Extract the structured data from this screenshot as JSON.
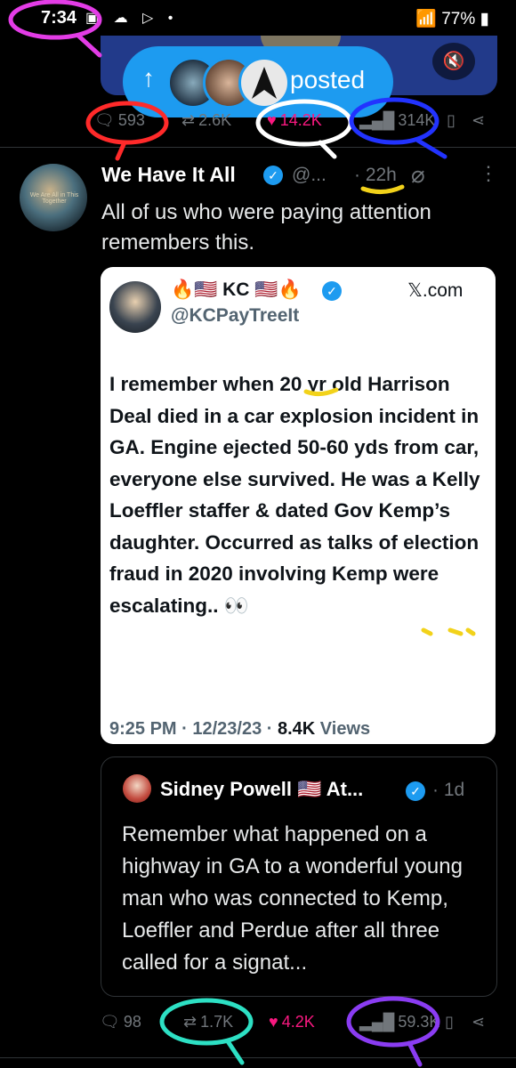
{
  "status_bar": {
    "time": "7:34",
    "left_icons": "▣ ☁ ▷ •",
    "right_text": "77%"
  },
  "media": {
    "posted_label": "posted",
    "arrow": "↑",
    "mute_icon": "🔇"
  },
  "top_actions": {
    "replies": "593",
    "reposts": "2.6K",
    "likes": "14.2K",
    "views": "314K"
  },
  "tweet": {
    "display_name": "We Have It All",
    "handle": "@...",
    "time_ago": "22h",
    "avatar_caption": "We Are All in This Together",
    "text": "All of us who were paying attention remembers this.",
    "actions": {
      "replies": "98",
      "reposts": "1.7K",
      "likes": "4.2K",
      "views": "59.3K"
    }
  },
  "image_card": {
    "name": "🔥🇺🇸 KC 🇺🇸🔥",
    "handle": "@KCPayTreeIt",
    "brand": "𝕏.com",
    "body": "I remember when 20 yr old Harrison Deal died in a car explosion incident in GA. Engine ejected 50-60 yds from car, everyone else survived. He was a Kelly Loeffler staffer & dated Gov Kemp’s daughter. Occurred as talks of election fraud in 2020 involving Kemp were escalating.. 👀",
    "meta_time": "9:25 PM · 12/23/23 · ",
    "meta_views": "8.4K",
    "meta_views_label": " Views"
  },
  "quoted": {
    "name": "Sidney Powell 🇺🇸 At...",
    "time": "· 1d",
    "text": "Remember what happened on a highway in GA to a wonderful young man who was connected to Kemp, Loeffler and Perdue after all three called for a signat..."
  },
  "colors": {
    "accent": "#1d9bf0",
    "like": "#f91880",
    "muted": "#71767b"
  }
}
